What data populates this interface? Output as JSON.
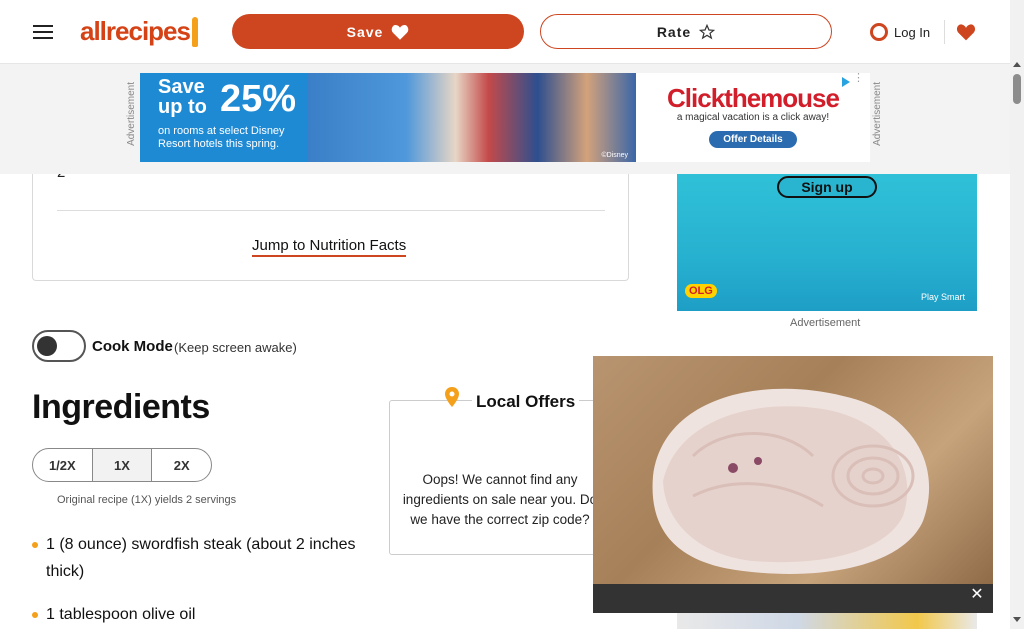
{
  "header": {
    "logo_text": "allrecipes",
    "save_label": "Save",
    "rate_label": "Rate",
    "login_label": "Log In",
    "brand_color": "#ce4620"
  },
  "top_ad": {
    "side_label": "Advertisement",
    "headline_save": "Save",
    "headline_upto": "up to",
    "headline_pct": "25%",
    "fine": "on rooms at select Disney Resort hotels this spring.",
    "photo_credit": "©Disney",
    "brand": "Clickthemouse",
    "tagline": "a magical vacation is a click away!",
    "cta": "Offer Details"
  },
  "recipe_card": {
    "step_number": "2",
    "jump_link": "Jump to Nutrition Facts"
  },
  "cook_mode": {
    "label": "Cook Mode",
    "sublabel": "(Keep screen awake)"
  },
  "ingredients": {
    "title": "Ingredients",
    "scales": [
      "1/2X",
      "1X",
      "2X"
    ],
    "active_scale": "1X",
    "yields_text": "Original recipe (1X) yields 2 servings",
    "items": [
      {
        "line1": "1 (8 ounce) swordfish steak (about 2 inches",
        "line2": "thick)"
      },
      {
        "line1": "1 tablespoon olive oil",
        "line2": ""
      }
    ]
  },
  "side_ad": {
    "signup_label": "Sign up",
    "olg_logo": "OLG",
    "play_smart": "Play Smart",
    "label": "Advertisement"
  },
  "local_offers": {
    "title": "Local Offers",
    "message": "Oops! We cannot find any ingredients on sale near you. Do we have the correct zip code?"
  },
  "video": {
    "close_symbol": "✕"
  }
}
